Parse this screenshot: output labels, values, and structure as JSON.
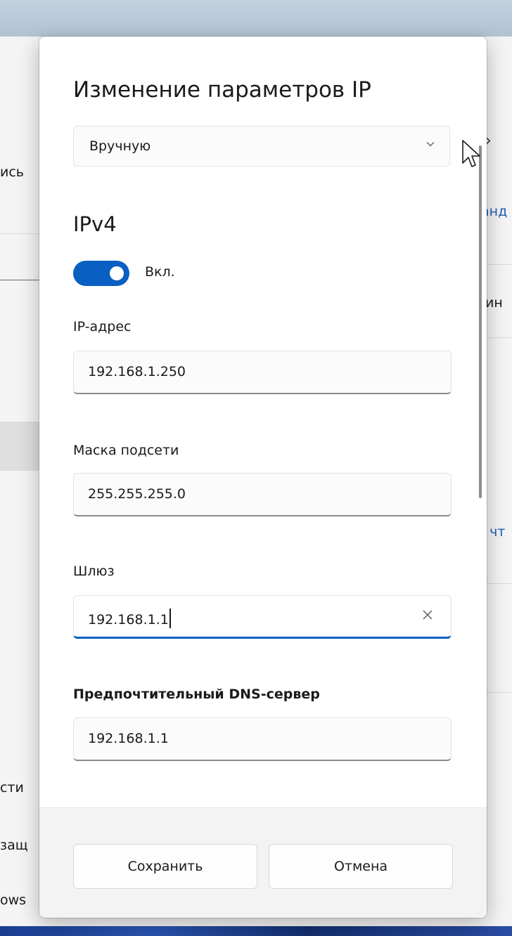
{
  "background": {
    "fragments": [
      "ись",
      "анд",
      "ин",
      ", чт",
      "сти",
      "защ",
      "ows"
    ]
  },
  "dialog": {
    "title": "Изменение параметров IP",
    "mode_select": {
      "value": "Вручную",
      "icon": "chevron-down-icon"
    },
    "section_title": "IPv4",
    "toggle": {
      "state": true,
      "label": "Вкл."
    },
    "fields": {
      "ip": {
        "label": "IP-адрес",
        "value": "192.168.1.250"
      },
      "subnet": {
        "label": "Маска подсети",
        "value": "255.255.255.0"
      },
      "gateway": {
        "label": "Шлюз",
        "value": "192.168.1.1",
        "focused": true,
        "clear_icon": "close-icon"
      },
      "dns": {
        "label": "Предпочтительный DNS-сервер",
        "value": "192.168.1.1"
      }
    },
    "buttons": {
      "save": "Сохранить",
      "cancel": "Отмена"
    }
  },
  "colors": {
    "accent": "#0a5fc2",
    "link": "#1f5fb2"
  }
}
